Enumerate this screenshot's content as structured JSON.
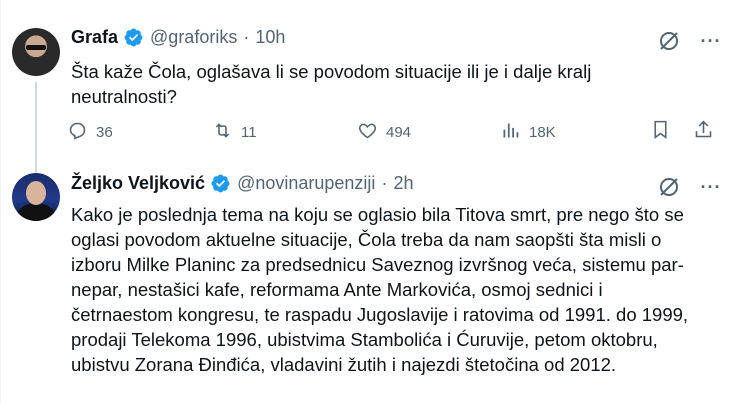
{
  "tweet1": {
    "author": {
      "name": "Grafa",
      "handle": "@graforiks",
      "time": "10h"
    },
    "text_line1": "Šta kaže Čola, oglašava li se povodom situacije ili je i dalje kralj",
    "text_line2": "neutralnosti?",
    "stats": {
      "replies": "36",
      "retweets": "11",
      "likes": "494",
      "views": "18K"
    }
  },
  "tweet2": {
    "author": {
      "name": "Željko Veljković",
      "handle": "@novinarupenziji",
      "time": "2h"
    },
    "lines": [
      "Kako je poslednja tema na koju se oglasio bila Titova smrt, pre nego što se",
      "oglasi povodom aktuelne situacije, Čola treba da nam saopšti šta misli o",
      "izboru Milke Planinc za predsednicu Saveznog izvršnog veća, sistemu par-",
      "nepar, nestašici kafe, reformama Ante Markovića, osmoj sednici i",
      "četrnaestom kongresu, te raspadu Jugoslavije i ratovima od 1991. do 1999,",
      "prodaji Telekoma 1996, ubistvima Stambolića i Ćuruvije, petom oktobru,",
      "ubistvu Zorana Đinđića, vladavini žutih i najezdi štetočina od 2012."
    ]
  },
  "ui": {
    "separator": "·",
    "more": "···"
  },
  "colors": {
    "verified_blue": "#1d9bf0",
    "secondary_text": "#536471",
    "divider": "#cfd9de"
  },
  "icons": [
    "verified-badge-icon",
    "grok-icon",
    "more-icon",
    "reply-icon",
    "retweet-icon",
    "like-icon",
    "views-icon",
    "bookmark-icon",
    "share-icon"
  ]
}
